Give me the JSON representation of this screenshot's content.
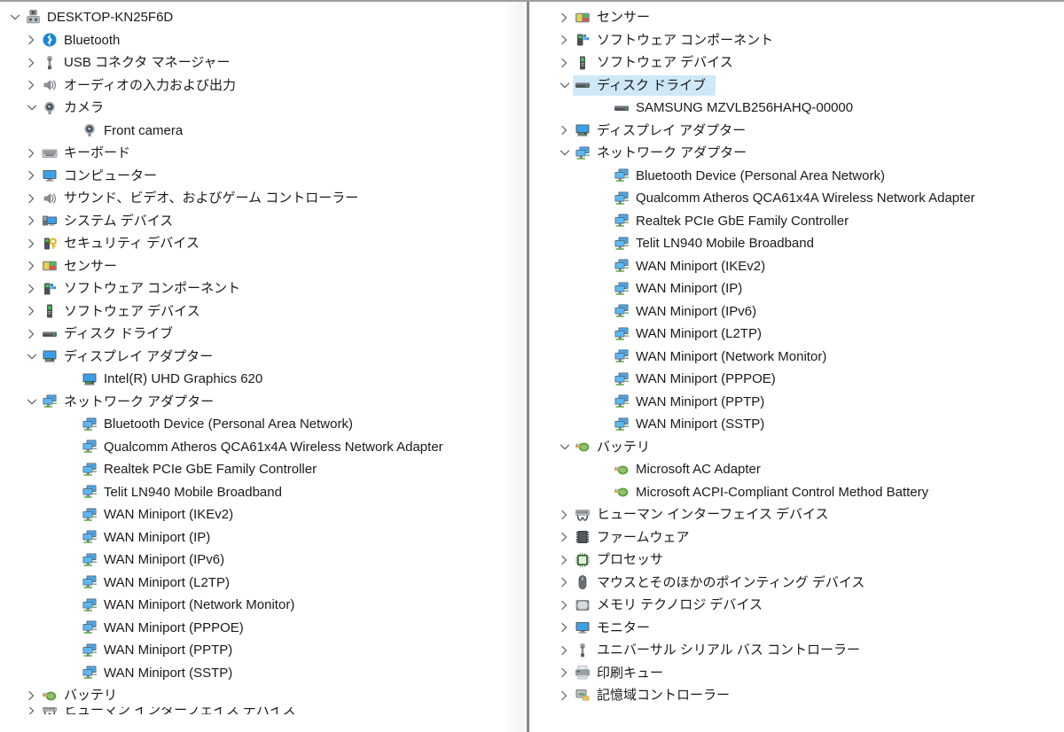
{
  "window": {
    "title": "DESKTOP-KN25F6D",
    "app": "Device Manager",
    "selection_color": "#cfe8f8",
    "text_color": "#1a1a1a"
  },
  "left_panel": {
    "name": "device-tree-left",
    "items": [
      {
        "label": "DESKTOP-KN25F6D",
        "level": 0,
        "state": "expanded",
        "icon": "computer-root-icon"
      },
      {
        "label": "Bluetooth",
        "level": 1,
        "state": "collapsed",
        "icon": "bluetooth-icon"
      },
      {
        "label": "USB コネクタ マネージャー",
        "level": 1,
        "state": "collapsed",
        "icon": "usb-connector-icon"
      },
      {
        "label": "オーディオの入力および出力",
        "level": 1,
        "state": "collapsed",
        "icon": "speaker-icon"
      },
      {
        "label": "カメラ",
        "level": 1,
        "state": "expanded",
        "icon": "camera-icon"
      },
      {
        "label": "Front camera",
        "level": 2,
        "state": "leaf",
        "icon": "camera-icon"
      },
      {
        "label": "キーボード",
        "level": 1,
        "state": "collapsed",
        "icon": "keyboard-icon"
      },
      {
        "label": "コンピューター",
        "level": 1,
        "state": "collapsed",
        "icon": "monitor-icon"
      },
      {
        "label": "サウンド、ビデオ、およびゲーム コントローラー",
        "level": 1,
        "state": "collapsed",
        "icon": "speaker-icon"
      },
      {
        "label": "システム デバイス",
        "level": 1,
        "state": "collapsed",
        "icon": "system-device-icon"
      },
      {
        "label": "セキュリティ デバイス",
        "level": 1,
        "state": "collapsed",
        "icon": "security-device-icon"
      },
      {
        "label": "センサー",
        "level": 1,
        "state": "collapsed",
        "icon": "sensor-icon"
      },
      {
        "label": "ソフトウェア コンポーネント",
        "level": 1,
        "state": "collapsed",
        "icon": "software-component-icon"
      },
      {
        "label": "ソフトウェア デバイス",
        "level": 1,
        "state": "collapsed",
        "icon": "software-device-icon"
      },
      {
        "label": "ディスク ドライブ",
        "level": 1,
        "state": "collapsed",
        "icon": "disk-drive-icon"
      },
      {
        "label": "ディスプレイ アダプター",
        "level": 1,
        "state": "expanded",
        "icon": "display-adapter-icon"
      },
      {
        "label": "Intel(R) UHD Graphics 620",
        "level": 2,
        "state": "leaf",
        "icon": "display-adapter-icon"
      },
      {
        "label": "ネットワーク アダプター",
        "level": 1,
        "state": "expanded",
        "icon": "network-adapter-icon"
      },
      {
        "label": "Bluetooth Device (Personal Area Network)",
        "level": 2,
        "state": "leaf",
        "icon": "network-adapter-icon"
      },
      {
        "label": "Qualcomm Atheros QCA61x4A Wireless Network Adapter",
        "level": 2,
        "state": "leaf",
        "icon": "network-adapter-icon"
      },
      {
        "label": "Realtek PCIe GbE Family Controller",
        "level": 2,
        "state": "leaf",
        "icon": "network-adapter-icon"
      },
      {
        "label": "Telit LN940 Mobile Broadband",
        "level": 2,
        "state": "leaf",
        "icon": "network-adapter-icon"
      },
      {
        "label": "WAN Miniport (IKEv2)",
        "level": 2,
        "state": "leaf",
        "icon": "network-adapter-icon"
      },
      {
        "label": "WAN Miniport (IP)",
        "level": 2,
        "state": "leaf",
        "icon": "network-adapter-icon"
      },
      {
        "label": "WAN Miniport (IPv6)",
        "level": 2,
        "state": "leaf",
        "icon": "network-adapter-icon"
      },
      {
        "label": "WAN Miniport (L2TP)",
        "level": 2,
        "state": "leaf",
        "icon": "network-adapter-icon"
      },
      {
        "label": "WAN Miniport (Network Monitor)",
        "level": 2,
        "state": "leaf",
        "icon": "network-adapter-icon"
      },
      {
        "label": "WAN Miniport (PPPOE)",
        "level": 2,
        "state": "leaf",
        "icon": "network-adapter-icon"
      },
      {
        "label": "WAN Miniport (PPTP)",
        "level": 2,
        "state": "leaf",
        "icon": "network-adapter-icon"
      },
      {
        "label": "WAN Miniport (SSTP)",
        "level": 2,
        "state": "leaf",
        "icon": "network-adapter-icon"
      },
      {
        "label": "バッテリ",
        "level": 1,
        "state": "collapsed",
        "icon": "battery-icon"
      },
      {
        "label": "ヒューマン インターフェイス デバイス",
        "level": 1,
        "state": "collapsed",
        "icon": "hid-icon"
      }
    ]
  },
  "right_panel": {
    "name": "device-tree-right",
    "selected_label": "ディスク ドライブ",
    "items": [
      {
        "label": "センサー",
        "level": 1,
        "state": "collapsed",
        "icon": "sensor-icon"
      },
      {
        "label": "ソフトウェア コンポーネント",
        "level": 1,
        "state": "collapsed",
        "icon": "software-component-icon"
      },
      {
        "label": "ソフトウェア デバイス",
        "level": 1,
        "state": "collapsed",
        "icon": "software-device-icon"
      },
      {
        "label": "ディスク ドライブ",
        "level": 1,
        "state": "expanded",
        "icon": "disk-drive-icon",
        "selected": true
      },
      {
        "label": "SAMSUNG MZVLB256HAHQ-00000",
        "level": 2,
        "state": "leaf",
        "icon": "disk-drive-icon"
      },
      {
        "label": "ディスプレイ アダプター",
        "level": 1,
        "state": "collapsed",
        "icon": "display-adapter-icon"
      },
      {
        "label": "ネットワーク アダプター",
        "level": 1,
        "state": "expanded",
        "icon": "network-adapter-icon"
      },
      {
        "label": "Bluetooth Device (Personal Area Network)",
        "level": 2,
        "state": "leaf",
        "icon": "network-adapter-icon"
      },
      {
        "label": "Qualcomm Atheros QCA61x4A Wireless Network Adapter",
        "level": 2,
        "state": "leaf",
        "icon": "network-adapter-icon"
      },
      {
        "label": "Realtek PCIe GbE Family Controller",
        "level": 2,
        "state": "leaf",
        "icon": "network-adapter-icon"
      },
      {
        "label": "Telit LN940 Mobile Broadband",
        "level": 2,
        "state": "leaf",
        "icon": "network-adapter-icon"
      },
      {
        "label": "WAN Miniport (IKEv2)",
        "level": 2,
        "state": "leaf",
        "icon": "network-adapter-icon"
      },
      {
        "label": "WAN Miniport (IP)",
        "level": 2,
        "state": "leaf",
        "icon": "network-adapter-icon"
      },
      {
        "label": "WAN Miniport (IPv6)",
        "level": 2,
        "state": "leaf",
        "icon": "network-adapter-icon"
      },
      {
        "label": "WAN Miniport (L2TP)",
        "level": 2,
        "state": "leaf",
        "icon": "network-adapter-icon"
      },
      {
        "label": "WAN Miniport (Network Monitor)",
        "level": 2,
        "state": "leaf",
        "icon": "network-adapter-icon"
      },
      {
        "label": "WAN Miniport (PPPOE)",
        "level": 2,
        "state": "leaf",
        "icon": "network-adapter-icon"
      },
      {
        "label": "WAN Miniport (PPTP)",
        "level": 2,
        "state": "leaf",
        "icon": "network-adapter-icon"
      },
      {
        "label": "WAN Miniport (SSTP)",
        "level": 2,
        "state": "leaf",
        "icon": "network-adapter-icon"
      },
      {
        "label": "バッテリ",
        "level": 1,
        "state": "expanded",
        "icon": "battery-icon"
      },
      {
        "label": "Microsoft AC Adapter",
        "level": 2,
        "state": "leaf",
        "icon": "battery-icon"
      },
      {
        "label": "Microsoft ACPI-Compliant Control Method Battery",
        "level": 2,
        "state": "leaf",
        "icon": "battery-icon"
      },
      {
        "label": "ヒューマン インターフェイス デバイス",
        "level": 1,
        "state": "collapsed",
        "icon": "hid-icon"
      },
      {
        "label": "ファームウェア",
        "level": 1,
        "state": "collapsed",
        "icon": "firmware-icon"
      },
      {
        "label": "プロセッサ",
        "level": 1,
        "state": "collapsed",
        "icon": "processor-icon"
      },
      {
        "label": "マウスとそのほかのポインティング デバイス",
        "level": 1,
        "state": "collapsed",
        "icon": "mouse-icon"
      },
      {
        "label": "メモリ テクノロジ デバイス",
        "level": 1,
        "state": "collapsed",
        "icon": "memory-icon"
      },
      {
        "label": "モニター",
        "level": 1,
        "state": "collapsed",
        "icon": "monitor-icon"
      },
      {
        "label": "ユニバーサル シリアル バス コントローラー",
        "level": 1,
        "state": "collapsed",
        "icon": "usb-connector-icon"
      },
      {
        "label": "印刷キュー",
        "level": 1,
        "state": "collapsed",
        "icon": "printer-icon"
      },
      {
        "label": "記憶域コントローラー",
        "level": 1,
        "state": "collapsed",
        "icon": "storage-controller-icon"
      }
    ]
  }
}
